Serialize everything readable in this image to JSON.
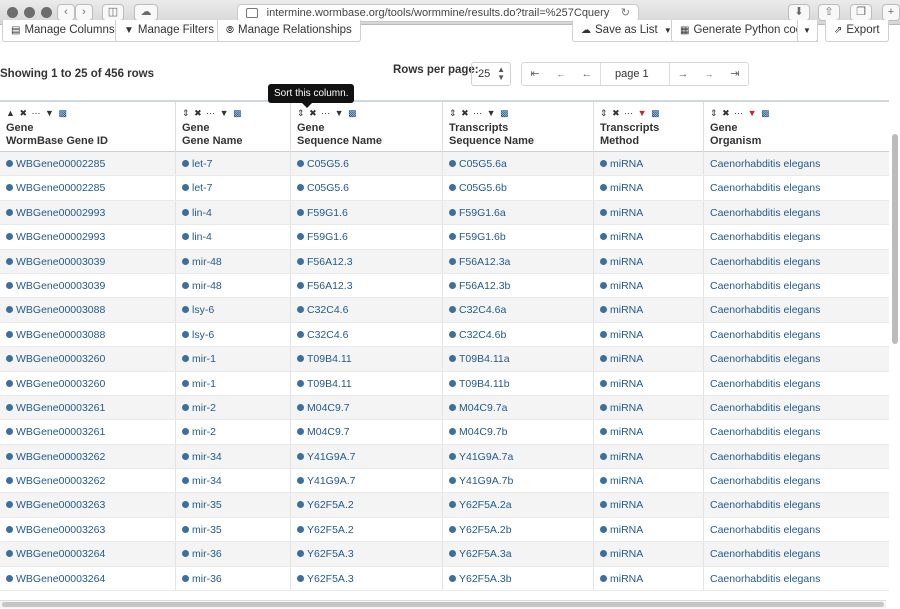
{
  "browser": {
    "url": "intermine.wormbase.org/tools/wormmine/results.do?trail=%257Cquery"
  },
  "toolbar": {
    "manage_columns": "Manage Columns",
    "manage_filters": "Manage Filters",
    "manage_relationships": "Manage Relationships",
    "save_as_list": "Save as List",
    "generate_code": "Generate Python code",
    "export": "Export"
  },
  "summary": {
    "showing": "Showing 1 to 25 of 456 rows"
  },
  "pagination": {
    "rows_per_page_label": "Rows per page:",
    "rows_per_page_value": "25",
    "current_page": "page 1"
  },
  "tooltip": "Sort this column.",
  "table": {
    "columns": [
      {
        "l1": "Gene",
        "l2": "WormBase Gene ID"
      },
      {
        "l1": "Gene",
        "l2": "Gene Name"
      },
      {
        "l1": "Gene",
        "l2": "Sequence Name"
      },
      {
        "l1": "Transcripts",
        "l2": "Sequence Name"
      },
      {
        "l1": "Transcripts",
        "l2": "Method"
      },
      {
        "l1": "Gene",
        "l2": "Organism"
      }
    ],
    "rows": [
      [
        "WBGene00002285",
        "let-7",
        "C05G5.6",
        "C05G5.6a",
        "miRNA",
        "Caenorhabditis elegans"
      ],
      [
        "WBGene00002285",
        "let-7",
        "C05G5.6",
        "C05G5.6b",
        "miRNA",
        "Caenorhabditis elegans"
      ],
      [
        "WBGene00002993",
        "lin-4",
        "F59G1.6",
        "F59G1.6a",
        "miRNA",
        "Caenorhabditis elegans"
      ],
      [
        "WBGene00002993",
        "lin-4",
        "F59G1.6",
        "F59G1.6b",
        "miRNA",
        "Caenorhabditis elegans"
      ],
      [
        "WBGene00003039",
        "mir-48",
        "F56A12.3",
        "F56A12.3a",
        "miRNA",
        "Caenorhabditis elegans"
      ],
      [
        "WBGene00003039",
        "mir-48",
        "F56A12.3",
        "F56A12.3b",
        "miRNA",
        "Caenorhabditis elegans"
      ],
      [
        "WBGene00003088",
        "lsy-6",
        "C32C4.6",
        "C32C4.6a",
        "miRNA",
        "Caenorhabditis elegans"
      ],
      [
        "WBGene00003088",
        "lsy-6",
        "C32C4.6",
        "C32C4.6b",
        "miRNA",
        "Caenorhabditis elegans"
      ],
      [
        "WBGene00003260",
        "mir-1",
        "T09B4.11",
        "T09B4.11a",
        "miRNA",
        "Caenorhabditis elegans"
      ],
      [
        "WBGene00003260",
        "mir-1",
        "T09B4.11",
        "T09B4.11b",
        "miRNA",
        "Caenorhabditis elegans"
      ],
      [
        "WBGene00003261",
        "mir-2",
        "M04C9.7",
        "M04C9.7a",
        "miRNA",
        "Caenorhabditis elegans"
      ],
      [
        "WBGene00003261",
        "mir-2",
        "M04C9.7",
        "M04C9.7b",
        "miRNA",
        "Caenorhabditis elegans"
      ],
      [
        "WBGene00003262",
        "mir-34",
        "Y41G9A.7",
        "Y41G9A.7a",
        "miRNA",
        "Caenorhabditis elegans"
      ],
      [
        "WBGene00003262",
        "mir-34",
        "Y41G9A.7",
        "Y41G9A.7b",
        "miRNA",
        "Caenorhabditis elegans"
      ],
      [
        "WBGene00003263",
        "mir-35",
        "Y62F5A.2",
        "Y62F5A.2a",
        "miRNA",
        "Caenorhabditis elegans"
      ],
      [
        "WBGene00003263",
        "mir-35",
        "Y62F5A.2",
        "Y62F5A.2b",
        "miRNA",
        "Caenorhabditis elegans"
      ],
      [
        "WBGene00003264",
        "mir-36",
        "Y62F5A.3",
        "Y62F5A.3a",
        "miRNA",
        "Caenorhabditis elegans"
      ],
      [
        "WBGene00003264",
        "mir-36",
        "Y62F5A.3",
        "Y62F5A.3b",
        "miRNA",
        "Caenorhabditis elegans"
      ]
    ]
  },
  "colors": {
    "link": "#235a8c",
    "filter_active": "#cc2222",
    "stripe": "#f4f4f4"
  }
}
